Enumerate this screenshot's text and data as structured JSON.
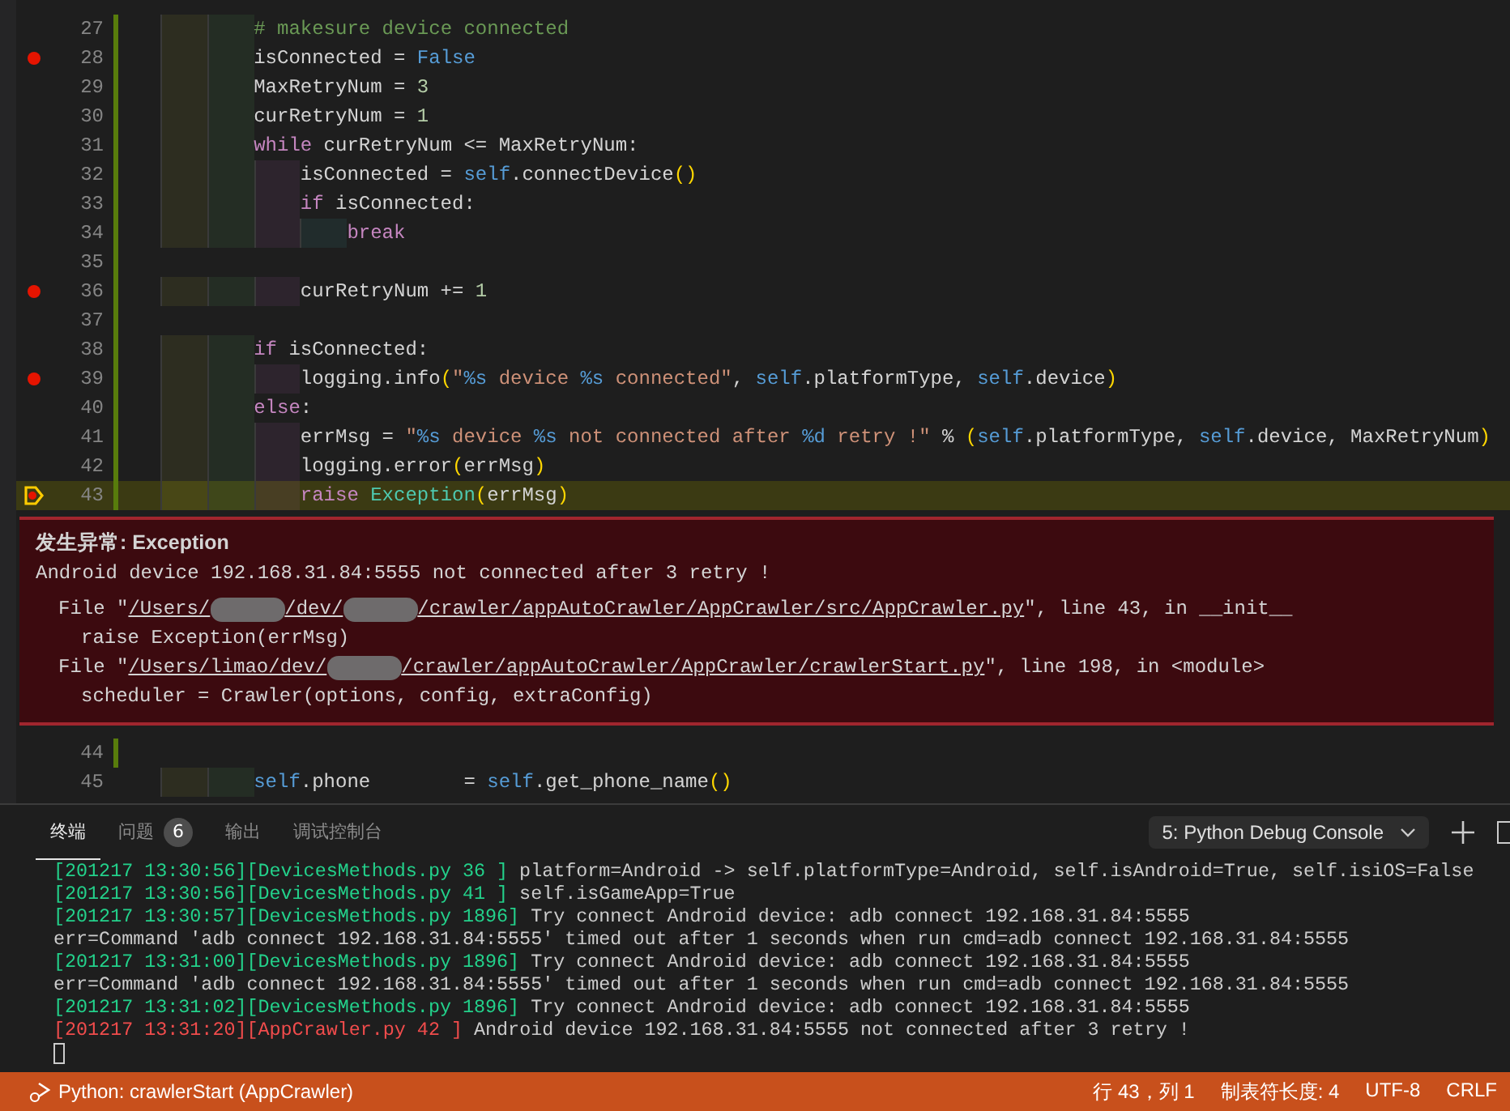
{
  "editor": {
    "lines": [
      {
        "number": "27",
        "modified": true,
        "breakpoint": false,
        "current": false,
        "tokens": [
          {
            "t": "# makesure device connected",
            "kind": "comment"
          }
        ]
      },
      {
        "number": "28",
        "modified": true,
        "breakpoint": true,
        "current": false,
        "tokens": [
          {
            "t": "isConnected = ",
            "kind": "plain"
          },
          {
            "t": "False",
            "kind": "const"
          }
        ]
      },
      {
        "number": "29",
        "modified": true,
        "breakpoint": false,
        "current": false,
        "tokens": [
          {
            "t": "MaxRetryNum = ",
            "kind": "plain"
          },
          {
            "t": "3",
            "kind": "num"
          }
        ]
      },
      {
        "number": "30",
        "modified": true,
        "breakpoint": false,
        "current": false,
        "tokens": [
          {
            "t": "curRetryNum = ",
            "kind": "plain"
          },
          {
            "t": "1",
            "kind": "num"
          }
        ]
      },
      {
        "number": "31",
        "modified": true,
        "breakpoint": false,
        "current": false,
        "tokens": [
          {
            "t": "while",
            "kind": "kw"
          },
          {
            "t": " curRetryNum <= MaxRetryNum:",
            "kind": "plain"
          }
        ],
        "children": [
          {
            "number": "32",
            "modified": true,
            "breakpoint": false,
            "current": false,
            "tokens": [
              {
                "t": "isConnected = ",
                "kind": "plain"
              },
              {
                "t": "self",
                "kind": "self"
              },
              {
                "t": ".connectDevice",
                "kind": "plain"
              },
              {
                "t": "()",
                "kind": "paren"
              }
            ]
          },
          {
            "number": "33",
            "modified": true,
            "breakpoint": false,
            "current": false,
            "tokens": [
              {
                "t": "if",
                "kind": "kw"
              },
              {
                "t": " isConnected:",
                "kind": "plain"
              }
            ],
            "children": [
              {
                "number": "34",
                "modified": true,
                "breakpoint": false,
                "current": false,
                "tokens": [
                  {
                    "t": "break",
                    "kind": "kw"
                  }
                ]
              }
            ]
          },
          {
            "number": "35",
            "modified": true,
            "breakpoint": false,
            "current": false
          },
          {
            "number": "36",
            "modified": true,
            "breakpoint": true,
            "current": false,
            "tokens": [
              {
                "t": "curRetryNum += ",
                "kind": "plain"
              },
              {
                "t": "1",
                "kind": "num"
              }
            ]
          }
        ]
      },
      {
        "number": "37",
        "modified": true,
        "breakpoint": false,
        "current": false
      },
      {
        "number": "38",
        "modified": true,
        "breakpoint": false,
        "current": false,
        "tokens": [
          {
            "t": "if",
            "kind": "kw"
          },
          {
            "t": " isConnected:",
            "kind": "plain"
          }
        ],
        "children": [
          {
            "number": "39",
            "modified": true,
            "breakpoint": true,
            "current": false,
            "tokens": [
              {
                "t": "logging.info",
                "kind": "plain"
              },
              {
                "t": "(",
                "kind": "paren"
              },
              {
                "t": "\"",
                "kind": "str"
              },
              {
                "t": "%s",
                "kind": "fmt"
              },
              {
                "t": " device ",
                "kind": "str"
              },
              {
                "t": "%s",
                "kind": "fmt"
              },
              {
                "t": " connected\"",
                "kind": "str"
              },
              {
                "t": ", ",
                "kind": "plain"
              },
              {
                "t": "self",
                "kind": "self"
              },
              {
                "t": ".platformType, ",
                "kind": "plain"
              },
              {
                "t": "self",
                "kind": "self"
              },
              {
                "t": ".device",
                "kind": "plain"
              },
              {
                "t": ")",
                "kind": "paren"
              }
            ]
          }
        ]
      },
      {
        "number": "40",
        "modified": true,
        "breakpoint": false,
        "current": false,
        "tokens": [
          {
            "t": "else",
            "kind": "kw"
          },
          {
            "t": ":",
            "kind": "plain"
          }
        ],
        "children": [
          {
            "number": "41",
            "modified": true,
            "breakpoint": false,
            "current": false,
            "tokens": [
              {
                "t": "errMsg = ",
                "kind": "plain"
              },
              {
                "t": "\"",
                "kind": "str"
              },
              {
                "t": "%s",
                "kind": "fmt"
              },
              {
                "t": " device ",
                "kind": "str"
              },
              {
                "t": "%s",
                "kind": "fmt"
              },
              {
                "t": " not connected after ",
                "kind": "str"
              },
              {
                "t": "%d",
                "kind": "fmt"
              },
              {
                "t": " retry !\"",
                "kind": "str"
              },
              {
                "t": " % ",
                "kind": "plain"
              },
              {
                "t": "(",
                "kind": "paren"
              },
              {
                "t": "self",
                "kind": "self"
              },
              {
                "t": ".platformType, ",
                "kind": "plain"
              },
              {
                "t": "self",
                "kind": "self"
              },
              {
                "t": ".device, MaxRetryNum",
                "kind": "plain"
              },
              {
                "t": ")",
                "kind": "paren"
              }
            ]
          },
          {
            "number": "42",
            "modified": true,
            "breakpoint": false,
            "current": false,
            "tokens": [
              {
                "t": "logging.error",
                "kind": "plain"
              },
              {
                "t": "(",
                "kind": "paren"
              },
              {
                "t": "errMsg",
                "kind": "plain"
              },
              {
                "t": ")",
                "kind": "paren"
              }
            ]
          },
          {
            "number": "43",
            "modified": true,
            "breakpoint": true,
            "current": true,
            "tokens": [
              {
                "t": "raise ",
                "kind": "kw"
              },
              {
                "t": "Exception",
                "kind": "cls"
              },
              {
                "t": "(",
                "kind": "paren"
              },
              {
                "t": "errMsg",
                "kind": "plain"
              },
              {
                "t": ")",
                "kind": "paren"
              }
            ]
          }
        ]
      }
    ],
    "exception": {
      "title": "发生异常: Exception",
      "message": "Android device 192.168.31.84:5555 not connected after 3 retry !",
      "stack": [
        {
          "prefix": "File \"",
          "path": [
            {
              "kind": "text",
              "t": "/Users/"
            },
            {
              "kind": "redacted"
            },
            {
              "kind": "text",
              "t": "/dev/"
            },
            {
              "kind": "redacted"
            },
            {
              "kind": "text",
              "t": "/crawler/appAutoCrawler/AppCrawler/src/AppCrawler.py"
            }
          ],
          "suffix": "\", line 43, in __init__",
          "code": "raise Exception(errMsg)"
        },
        {
          "prefix": "File \"",
          "path": [
            {
              "kind": "text",
              "t": "/Users/limao/dev/"
            },
            {
              "kind": "redacted"
            },
            {
              "kind": "text",
              "t": "/crawler/appAutoCrawler/AppCrawler/crawlerStart.py"
            }
          ],
          "suffix": "\", line 198, in <module>",
          "code": "scheduler = Crawler(options, config, extraConfig)"
        }
      ]
    },
    "after_lines": [
      {
        "number": "44",
        "modified": true,
        "breakpoint": false,
        "current": false
      },
      {
        "number": "45",
        "modified": false,
        "breakpoint": false,
        "current": false,
        "tokens": [
          {
            "t": "self",
            "kind": "self"
          },
          {
            "t": ".phone        = ",
            "kind": "plain"
          },
          {
            "t": "self",
            "kind": "self"
          },
          {
            "t": ".get_phone_name",
            "kind": "plain"
          },
          {
            "t": "()",
            "kind": "paren"
          }
        ]
      }
    ]
  },
  "panel": {
    "tabs": [
      {
        "label": "终端",
        "selected": true
      },
      {
        "label": "问题",
        "selected": false,
        "badge": "6"
      },
      {
        "label": "输出",
        "selected": false
      },
      {
        "label": "调试控制台",
        "selected": false
      }
    ],
    "terminal_select": "5: Python Debug Console",
    "terminal": [
      [
        {
          "kind": "prefix",
          "t": "[201217 13:30:56][DevicesMethods.py 36 ]"
        },
        {
          "kind": "text",
          "t": " platform=Android -> self.platformType=Android, self.isAndroid=True, self.isiOS=False"
        }
      ],
      [
        {
          "kind": "prefix",
          "t": "[201217 13:30:56][DevicesMethods.py 41 ]"
        },
        {
          "kind": "text",
          "t": " self.isGameApp=True"
        }
      ],
      [
        {
          "kind": "prefix",
          "t": "[201217 13:30:57][DevicesMethods.py 1896]"
        },
        {
          "kind": "text",
          "t": " Try connect Android device: adb connect 192.168.31.84:5555"
        }
      ],
      [
        {
          "kind": "text",
          "t": "err=Command 'adb connect 192.168.31.84:5555' timed out after 1 seconds when run cmd=adb connect 192.168.31.84:5555"
        }
      ],
      [
        {
          "kind": "prefix",
          "t": "[201217 13:31:00][DevicesMethods.py 1896]"
        },
        {
          "kind": "text",
          "t": " Try connect Android device: adb connect 192.168.31.84:5555"
        }
      ],
      [
        {
          "kind": "text",
          "t": "err=Command 'adb connect 192.168.31.84:5555' timed out after 1 seconds when run cmd=adb connect 192.168.31.84:5555"
        }
      ],
      [
        {
          "kind": "prefix",
          "t": "[201217 13:31:02][DevicesMethods.py 1896]"
        },
        {
          "kind": "text",
          "t": " Try connect Android device: adb connect 192.168.31.84:5555"
        }
      ],
      [
        {
          "kind": "error",
          "t": "[201217 13:31:20][AppCrawler.py 42 ]"
        },
        {
          "kind": "text",
          "t": " Android device 192.168.31.84:5555 not connected after 3 retry !"
        }
      ]
    ]
  },
  "status_bar": {
    "debug_target": "Python: crawlerStart (AppCrawler)",
    "items": [
      "行 43，列 1",
      "制表符长度: 4",
      "UTF-8",
      "CRLF"
    ]
  }
}
